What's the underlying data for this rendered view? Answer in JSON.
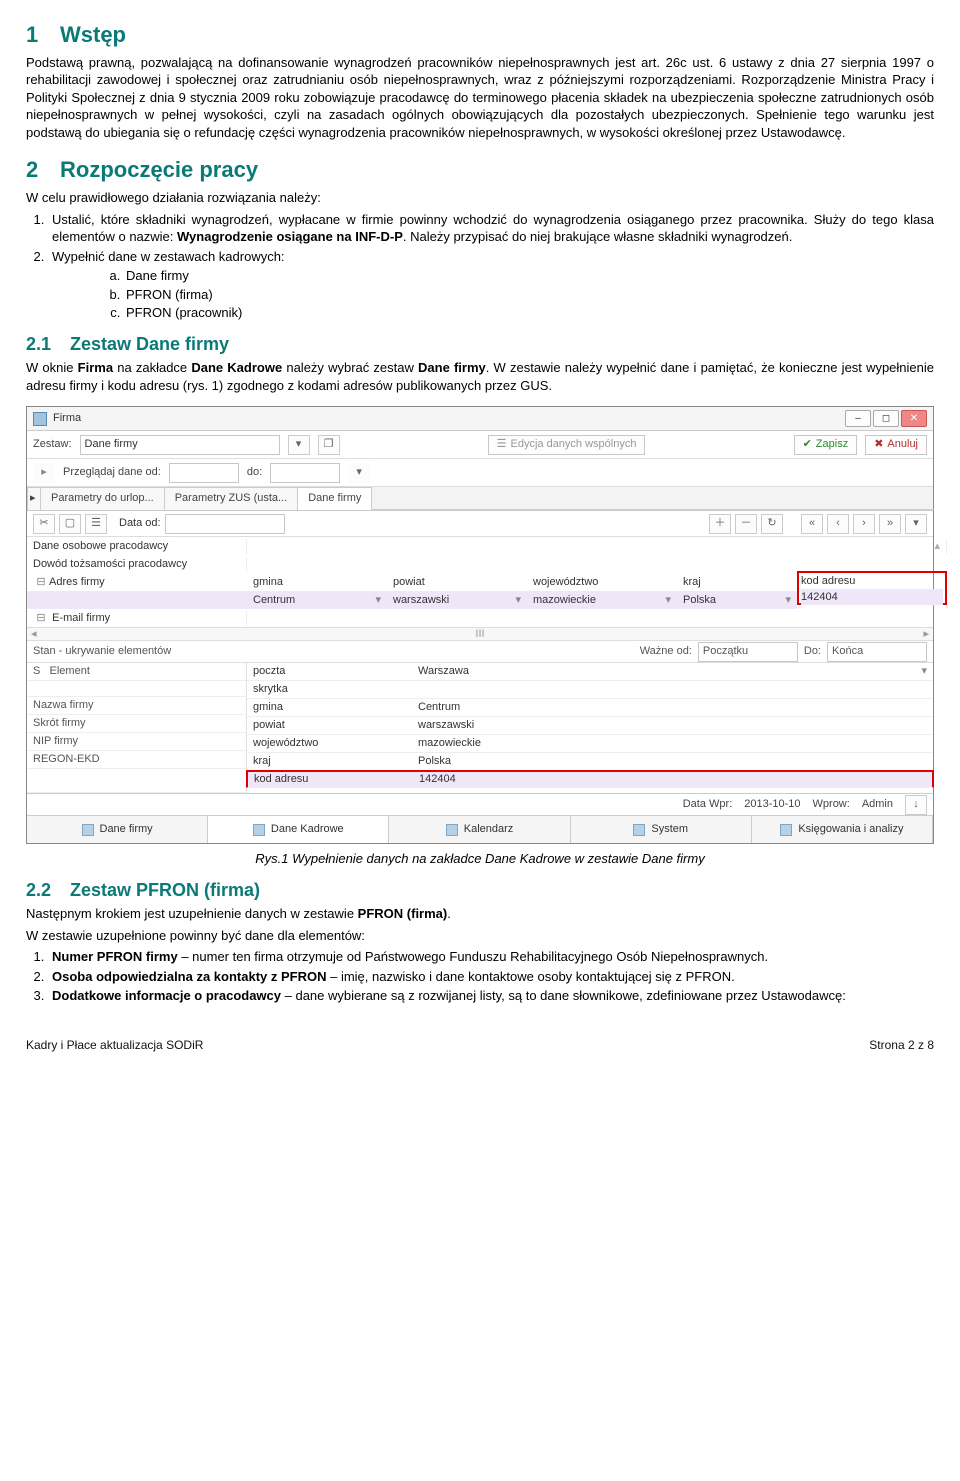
{
  "doc": {
    "s1": {
      "num": "1",
      "title": "Wstęp",
      "p1": "Podstawą prawną, pozwalającą na dofinansowanie wynagrodzeń pracowników niepełnosprawnych jest art. 26c ust. 6 ustawy z dnia 27 sierpnia 1997 o rehabilitacji zawodowej i społecznej oraz zatrudnianiu osób niepełnosprawnych, wraz z późniejszymi rozporządzeniami. Rozporządzenie Ministra Pracy i Polityki Społecznej z dnia 9 stycznia 2009 roku zobowiązuje pracodawcę do terminowego płacenia składek na ubezpieczenia społeczne zatrudnionych osób niepełnosprawnych w pełnej wysokości, czyli na zasadach ogólnych obowiązujących dla pozostałych ubezpieczonych. Spełnienie tego warunku jest podstawą do ubiegania się o refundację części wynagrodzenia pracowników niepełnosprawnych, w wysokości określonej przez Ustawodawcę."
    },
    "s2": {
      "num": "2",
      "title": "Rozpoczęcie pracy",
      "intro": "W celu prawidłowego działania rozwiązania należy:",
      "l1a": "Ustalić, które składniki wynagrodzeń, wypłacane w firmie powinny wchodzić do wynagrodzenia osiąganego przez pracownika. Służy do tego klasa elementów o nazwie: ",
      "l1b": "Wynagrodzenie osiągane na INF-D-P",
      "l1c": ". Należy przypisać do niej brakujące własne składniki wynagrodzeń.",
      "l2": "Wypełnić dane w zestawach kadrowych:",
      "la": "Dane firmy",
      "lb": "PFRON (firma)",
      "lc": "PFRON (pracownik)"
    },
    "s21": {
      "num": "2.1",
      "title": "Zestaw Dane firmy",
      "p_pre": "W oknie ",
      "w1": "Firma",
      "p_mid1": " na zakładce ",
      "w2": "Dane Kadrowe",
      "p_mid2": " należy wybrać zestaw ",
      "w3": "Dane firmy",
      "p_post": ". W zestawie należy wypełnić dane i pamiętać, że konieczne jest wypełnienie adresu firmy i kodu adresu (rys. 1) zgodnego z kodami adresów publikowanych przez GUS."
    },
    "fig1": "Rys.1 Wypełnienie danych na zakładce Dane Kadrowe w zestawie Dane firmy",
    "s22": {
      "num": "2.2",
      "title": "Zestaw PFRON (firma)",
      "p1a": "Następnym krokiem jest uzupełnienie danych w zestawie ",
      "p1b": "PFRON (firma)",
      "p1c": ".",
      "p2": "W zestawie uzupełnione powinny być dane dla elementów:",
      "li1a": "Numer PFRON firmy",
      "li1b": " – numer ten firma otrzymuje od Państwowego Funduszu Rehabilitacyjnego Osób Niepełnosprawnych.",
      "li2a": "Osoba odpowiedzialna za kontakty z PFRON",
      "li2b": " – imię, nazwisko i dane kontaktowe osoby kontaktującej się z PFRON.",
      "li3a": "Dodatkowe informacje o pracodawcy",
      "li3b": " – dane wybierane są z rozwijanej listy, są to dane słownikowe, zdefiniowane przez Ustawodawcę:"
    },
    "footer_left": "Kadry i Płace aktualizacja SODiR",
    "footer_right": "Strona 2 z 8"
  },
  "app": {
    "title": "Firma",
    "toolbar": {
      "zestaw_lbl": "Zestaw:",
      "zestaw_val": "Dane firmy",
      "edycja": "Edycja danych wspólnych",
      "zapisz": "Zapisz",
      "anuluj": "Anuluj",
      "przegladaj": "Przeglądaj dane od:",
      "do": "do:"
    },
    "tabs": {
      "t1": "Parametry do urlop...",
      "t2": "Parametry ZUS (usta...",
      "t3": "Dane firmy"
    },
    "bar2": {
      "dataod": "Data od:"
    },
    "grid": {
      "r1": "Dane osobowe pracodawcy",
      "r2": "Dowód tożsamości pracodawcy",
      "r3": "Adres firmy",
      "r4": "E-mail firmy",
      "h_gmina": "gmina",
      "h_powiat": "powiat",
      "h_woj": "województwo",
      "h_kraj": "kraj",
      "h_kod": "kod adresu",
      "v_gmina": "Centrum",
      "v_powiat": "warszawski",
      "v_woj": "mazowieckie",
      "v_kraj": "Polska",
      "v_kod": "142404"
    },
    "midbar": {
      "stan": "Stan - ukrywanie elementów",
      "wazne": "Ważne od:",
      "poczatku": "Początku",
      "do": "Do:",
      "konca": "Końca"
    },
    "leftcol": {
      "s": "S",
      "element": "Element",
      "nazwa": "Nazwa firmy",
      "skrot": "Skrót firmy",
      "nip": "NIP firmy",
      "regon": "REGON-EKD"
    },
    "kv": {
      "poczta": "poczta",
      "poczta_v": "Warszawa",
      "skrytka": "skrytka",
      "skrytka_v": "",
      "gmina": "gmina",
      "gmina_v": "Centrum",
      "powiat": "powiat",
      "powiat_v": "warszawski",
      "woj": "województwo",
      "woj_v": "mazowieckie",
      "kraj": "kraj",
      "kraj_v": "Polska",
      "kod": "kod adresu",
      "kod_v": "142404"
    },
    "footerbar": {
      "datawpr_l": "Data Wpr:",
      "datawpr_v": "2013-10-10",
      "wprow_l": "Wprow:",
      "wprow_v": "Admin"
    },
    "bottomtabs": {
      "t1": "Dane firmy",
      "t2": "Dane Kadrowe",
      "t3": "Kalendarz",
      "t4": "System",
      "t5": "Księgowania i analizy"
    }
  }
}
